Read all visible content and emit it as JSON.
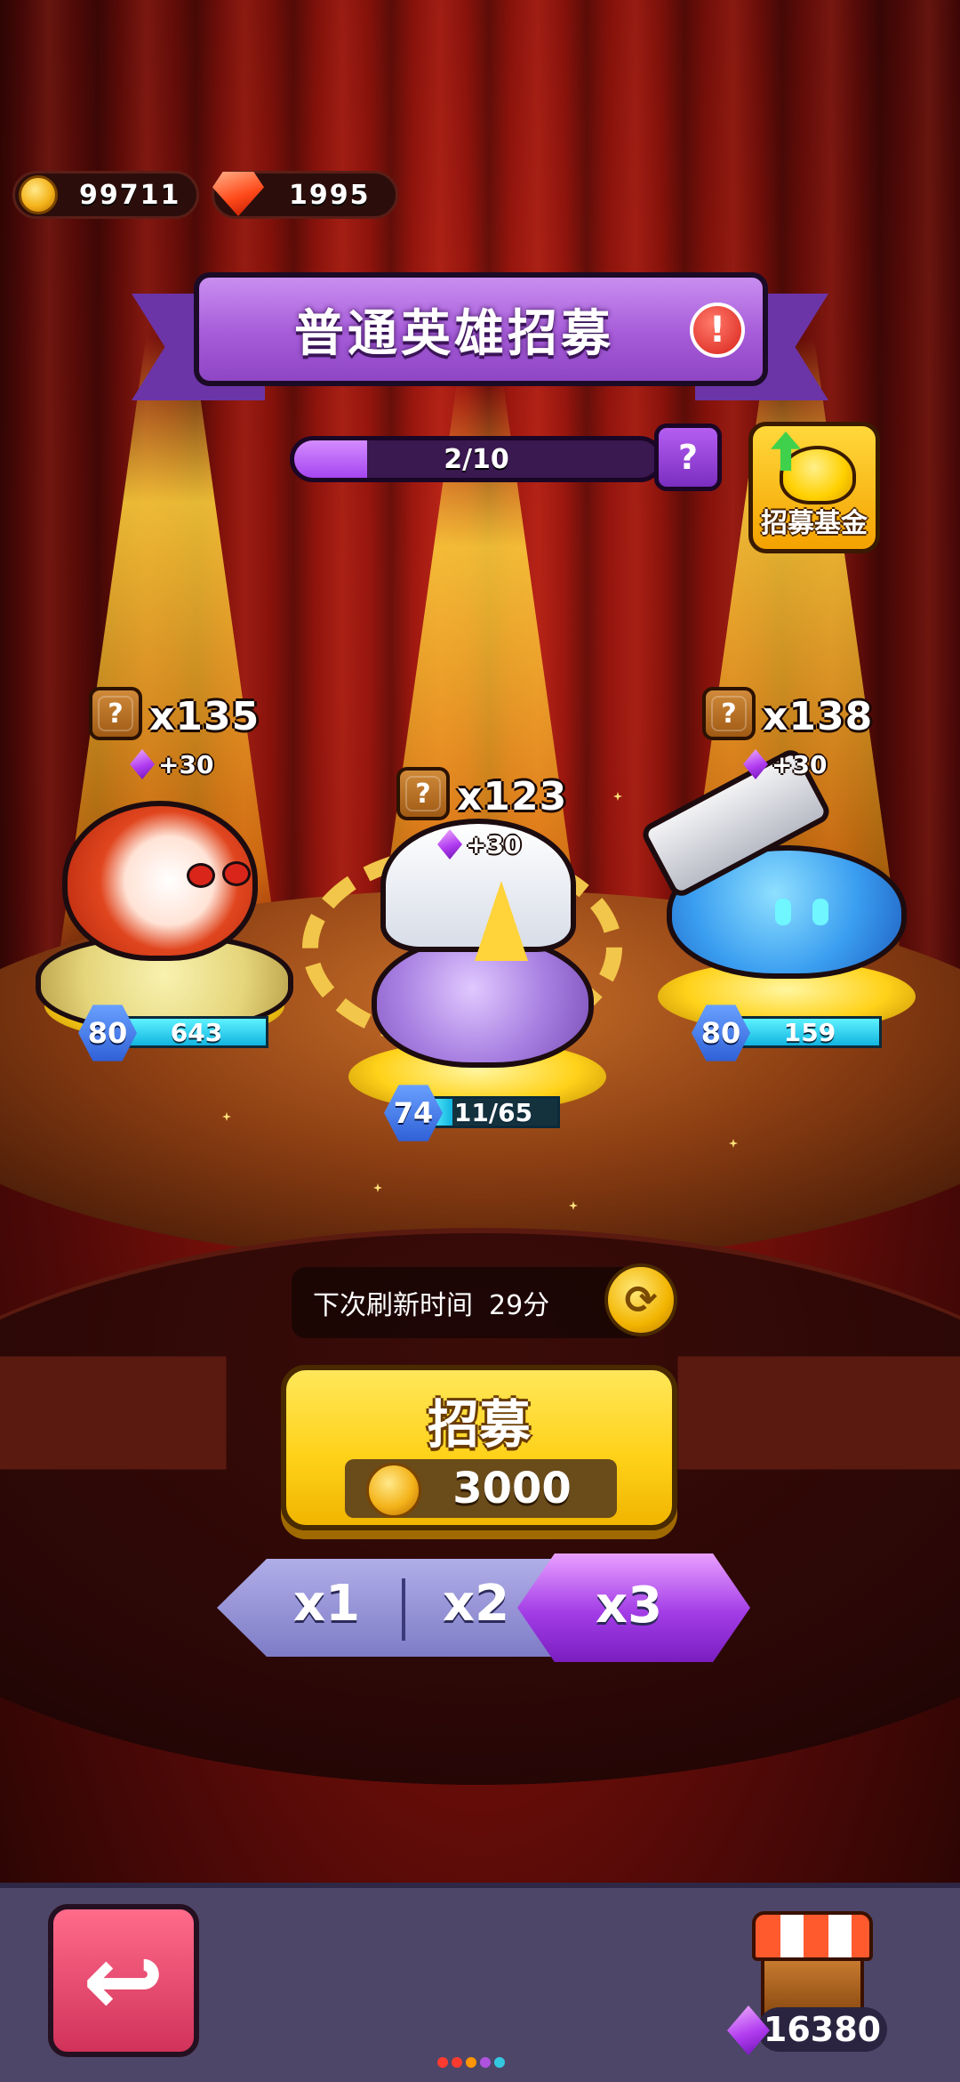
{
  "currency": {
    "coins": "99711",
    "gems": "1995"
  },
  "banner": {
    "title": "普通英雄招募"
  },
  "progress": {
    "text": "2/10",
    "fraction": 0.2
  },
  "fund": {
    "label": "招募基金"
  },
  "heroes": [
    {
      "name": "monkey-king-hero",
      "count": "x135",
      "bonus": "+30",
      "level": "80",
      "shards": "643"
    },
    {
      "name": "mage-hero",
      "count": "x123",
      "bonus": "+30",
      "level": "74",
      "shards": "11/65"
    },
    {
      "name": "cannon-robot-hero",
      "count": "x138",
      "bonus": "+30",
      "level": "80",
      "shards": "159"
    }
  ],
  "refresh": {
    "label": "下次刷新时间",
    "time": "29分"
  },
  "recruit": {
    "label": "招募",
    "cost": "3000"
  },
  "multipliers": {
    "x1": "x1",
    "x2": "x2",
    "x3": "x3",
    "selected": "x3"
  },
  "bottom": {
    "diamonds": "16380"
  },
  "colors": {
    "accent_purple": "#a546f0",
    "gold": "#ffd21a",
    "curtain_red": "#8a120b"
  }
}
